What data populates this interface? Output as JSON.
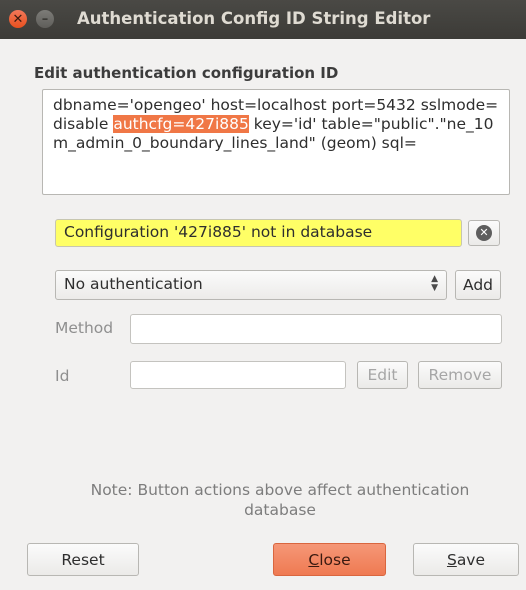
{
  "window": {
    "title": "Authentication Config ID String Editor",
    "close_glyph": "✕",
    "minimize_glyph": "–"
  },
  "editor": {
    "section_label": "Edit authentication configuration ID",
    "connection_before": "dbname='opengeo' host=localhost port=5432 sslmode=disable ",
    "connection_highlight": "authcfg=427i885",
    "connection_after": " key='id' table=\"public\".\"ne_10m_admin_0_boundary_lines_land\" (geom) sql="
  },
  "status": {
    "message": "Configuration '427i885' not in database",
    "clear_glyph": "✕"
  },
  "auth": {
    "selected": "No authentication",
    "add_label": "Add",
    "method_label": "Method",
    "method_value": "",
    "id_label": "Id",
    "id_value": "",
    "edit_label": "Edit",
    "remove_label": "Remove"
  },
  "note": "Note: Button actions above affect authentication database",
  "buttons": {
    "reset": "Reset",
    "close_first": "C",
    "close_rest": "lose",
    "save_first": "S",
    "save_rest": "ave"
  },
  "colors": {
    "highlight": "#f07746",
    "status_bg": "#ffff66",
    "close_button": "#ef7a52",
    "titlebar": "#3c3b37"
  }
}
